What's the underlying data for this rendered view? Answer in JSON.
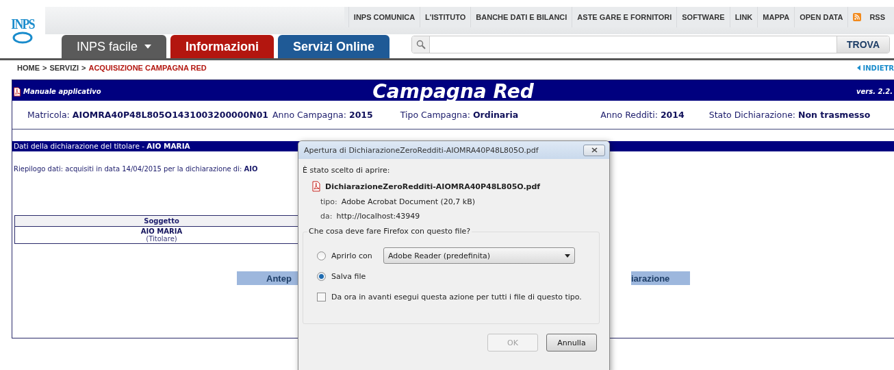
{
  "logo": {
    "text": "INPS"
  },
  "top_links": [
    "INPS COMUNICA",
    "L'ISTITUTO",
    "BANCHE DATI E BILANCI",
    "ASTE GARE E FORNITORI",
    "SOFTWARE",
    "LINK",
    "MAPPA",
    "OPEN DATA"
  ],
  "rss": {
    "label": "RSS"
  },
  "tabs": [
    {
      "label": "INPS facile",
      "color": "#5a5a5a",
      "dropdown": true
    },
    {
      "label": "Informazioni",
      "color": "#b3160f",
      "dropdown": false
    },
    {
      "label": "Servizi Online",
      "color": "#1f5a96",
      "dropdown": false
    }
  ],
  "search": {
    "button": "TROVA"
  },
  "breadcrumb": [
    {
      "label": "HOME",
      "current": false
    },
    {
      "label": "SERVIZI",
      "current": false
    },
    {
      "label": "ACQUISIZIONE CAMPAGNA RED",
      "current": true
    }
  ],
  "breadcrumb_separators": [
    ">",
    ">"
  ],
  "back_link": "INDIETR",
  "banner": {
    "manual": "Manuale applicativo",
    "title": "Campagna Red",
    "version": "vers. 2.2."
  },
  "info": [
    {
      "label": "Matricola:",
      "value": "AIOMRA40P48L805O1431003200000N01"
    },
    {
      "label": "Anno Campagna:",
      "value": "2015"
    },
    {
      "label": "Tipo Campagna:",
      "value": "Ordinaria"
    },
    {
      "label": "Anno Redditi:",
      "value": "2014"
    },
    {
      "label": "Stato Dichiarazione:",
      "value": "Non trasmesso"
    }
  ],
  "section_title": "Dati della dichiarazione del titolare - **AIO MARIA**",
  "summary": "Riepilogo dati: acquisiti in data 14/04/2015 per la dichiarazione di: **AIO**",
  "table": {
    "columns": [
      "Soggetto"
    ],
    "rows": [
      {
        "name": "AIO MARIA",
        "role": "(Titolare)"
      }
    ]
  },
  "buttons": [
    "Antep",
    "iarazione"
  ],
  "dialog": {
    "title": "Apertura di DichiarazioneZeroRedditi-AIOMRA40P48L805O.pdf",
    "intro": "È stato scelto di aprire:",
    "file": "DichiarazioneZeroRedditi-AIOMRA40P48L805O.pdf",
    "type_label": "tipo:",
    "type_value": "Adobe Acrobat Document (20,7 kB)",
    "from_label": "da:",
    "from_value": "http://localhost:43949",
    "question": "Che cosa deve fare Firefox con questo file?",
    "options": [
      {
        "label": "Aprirlo con",
        "selected": false,
        "app": "Adobe Reader  (predefinita)"
      },
      {
        "label": "Salva file",
        "selected": true
      }
    ],
    "remember": {
      "label": "Da ora in avanti esegui questa azione per tutti i file di questo tipo.",
      "checked": false
    },
    "actions": [
      {
        "label": "OK",
        "disabled": true
      },
      {
        "label": "Annulla",
        "disabled": false
      }
    ]
  }
}
